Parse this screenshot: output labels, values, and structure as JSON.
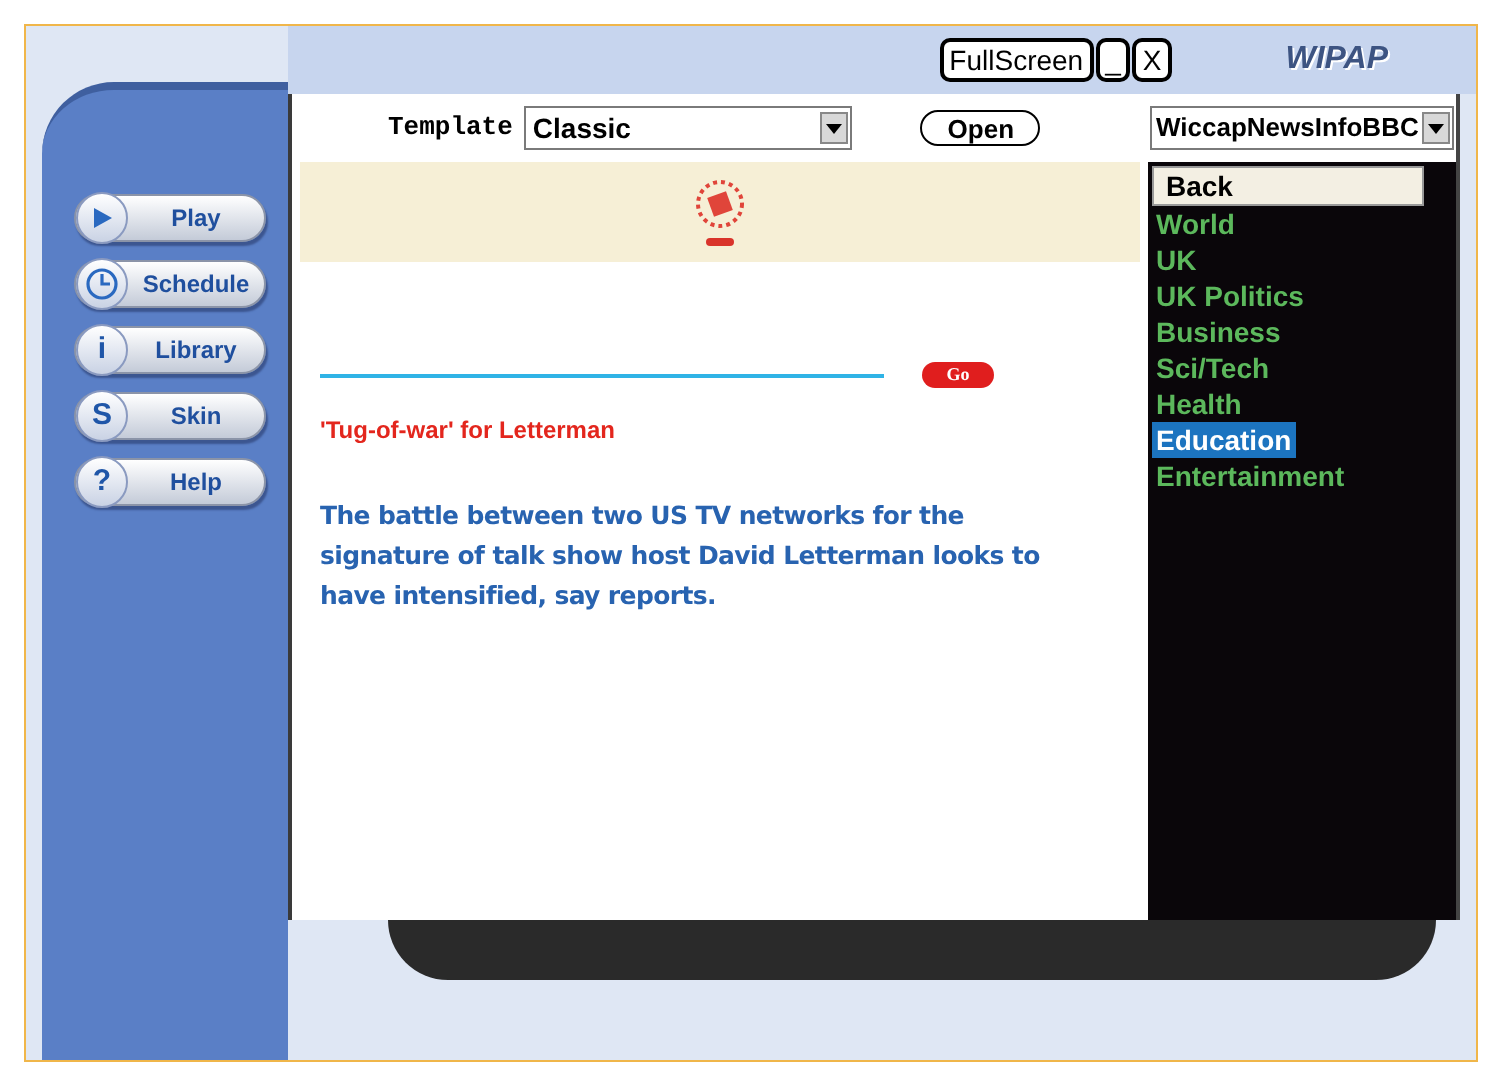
{
  "window_controls": [
    {
      "label": "FullScreen"
    },
    {
      "label": "_"
    },
    {
      "label": "X"
    }
  ],
  "logo": "WIPAP",
  "nav": [
    {
      "label": "Play",
      "kind": "play"
    },
    {
      "label": "Schedule",
      "kind": "clock"
    },
    {
      "label": "Library",
      "kind": "glyph",
      "glyph": "i"
    },
    {
      "label": "Skin",
      "kind": "glyph",
      "glyph": "S"
    },
    {
      "label": "Help",
      "kind": "glyph",
      "glyph": "?"
    }
  ],
  "toolbar": {
    "template_label": "Template",
    "template_value": "Classic",
    "open_button": "Open",
    "source_value": "WiccapNewsInfoBBC"
  },
  "article": {
    "go_button": "Go",
    "headline": "'Tug-of-war' for Letterman",
    "body": "The battle between two US TV networks for the signature of talk show host David Letterman looks to have intensified, say reports."
  },
  "category_list": {
    "header": "Back",
    "items": [
      {
        "label": "World",
        "selected": false
      },
      {
        "label": "UK",
        "selected": false
      },
      {
        "label": "UK Politics",
        "selected": false
      },
      {
        "label": "Business",
        "selected": false
      },
      {
        "label": "Sci/Tech",
        "selected": false
      },
      {
        "label": "Health",
        "selected": false
      },
      {
        "label": "Education",
        "selected": true
      },
      {
        "label": "Entertainment",
        "selected": false
      }
    ]
  }
}
